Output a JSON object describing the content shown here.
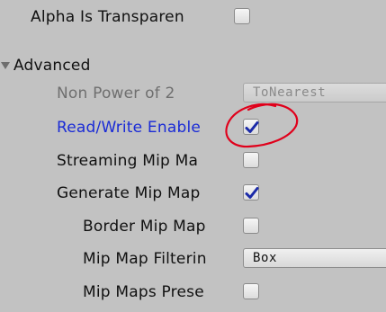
{
  "inspector": {
    "alpha_transparency": {
      "label": "Alpha Is Transparen",
      "checked": false
    },
    "advanced": {
      "label": "Advanced",
      "expanded": true
    },
    "non_power_of_2": {
      "label": "Non Power of 2",
      "value": "ToNearest"
    },
    "read_write": {
      "label": "Read/Write Enable",
      "checked": true
    },
    "streaming_mip": {
      "label": "Streaming Mip Ma",
      "checked": false
    },
    "generate_mip": {
      "label": "Generate Mip Map",
      "checked": true
    },
    "border_mip": {
      "label": "Border Mip Map",
      "checked": false
    },
    "mip_filtering": {
      "label": "Mip Map Filterin",
      "value": "Box"
    },
    "mip_preserve": {
      "label": "Mip Maps Prese",
      "checked": false
    }
  },
  "annotation": {
    "color": "#e0001b",
    "shape": "hand-drawn-ellipse"
  },
  "icons": {
    "fold": "triangle-down-icon",
    "check": "checkmark-icon"
  },
  "colors": {
    "background": "#c2c2c2",
    "modified_label": "#1a2bd6",
    "disabled_label": "#6f6f6f",
    "checkmark": "#1b2aa8"
  }
}
